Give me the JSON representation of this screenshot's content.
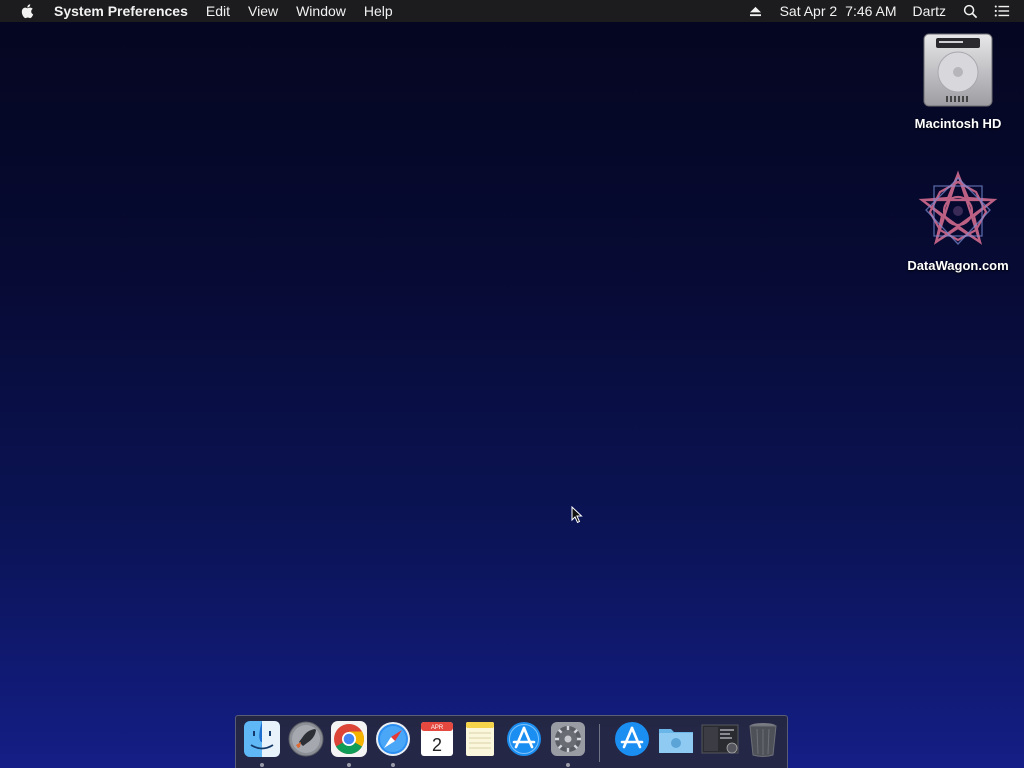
{
  "menubar": {
    "app_name": "System Preferences",
    "menus": [
      "Edit",
      "View",
      "Window",
      "Help"
    ],
    "date": "Sat Apr 2",
    "time": "7:46 AM",
    "user": "Dartz"
  },
  "desktop": {
    "icons": [
      {
        "label": "Macintosh HD",
        "icon": "hard-drive-icon"
      },
      {
        "label": "DataWagon.com",
        "icon": "datawagon-disk-icon"
      }
    ]
  },
  "dock": {
    "apps": [
      {
        "name": "Finder",
        "icon": "finder-icon",
        "running": true
      },
      {
        "name": "Launchpad",
        "icon": "launchpad-icon",
        "running": false
      },
      {
        "name": "Google Chrome",
        "icon": "chrome-icon",
        "running": true
      },
      {
        "name": "Safari",
        "icon": "safari-icon",
        "running": true
      },
      {
        "name": "Calendar",
        "icon": "calendar-icon",
        "running": false,
        "month": "APR",
        "day": "2"
      },
      {
        "name": "Notes",
        "icon": "notes-icon",
        "running": false
      },
      {
        "name": "App Store",
        "icon": "app-store-icon",
        "running": false
      },
      {
        "name": "System Preferences",
        "icon": "system-preferences-icon",
        "running": true
      }
    ],
    "others": [
      {
        "name": "Applications",
        "icon": "applications-folder-icon"
      },
      {
        "name": "Downloads",
        "icon": "downloads-folder-icon"
      },
      {
        "name": "Screenshot",
        "icon": "screenshot-thumbnail-icon"
      },
      {
        "name": "Trash",
        "icon": "trash-icon"
      }
    ]
  },
  "colors": {
    "menubar_bg": "#1c1c1e",
    "desktop_top": "#05061f",
    "desktop_bottom": "#141e86"
  }
}
